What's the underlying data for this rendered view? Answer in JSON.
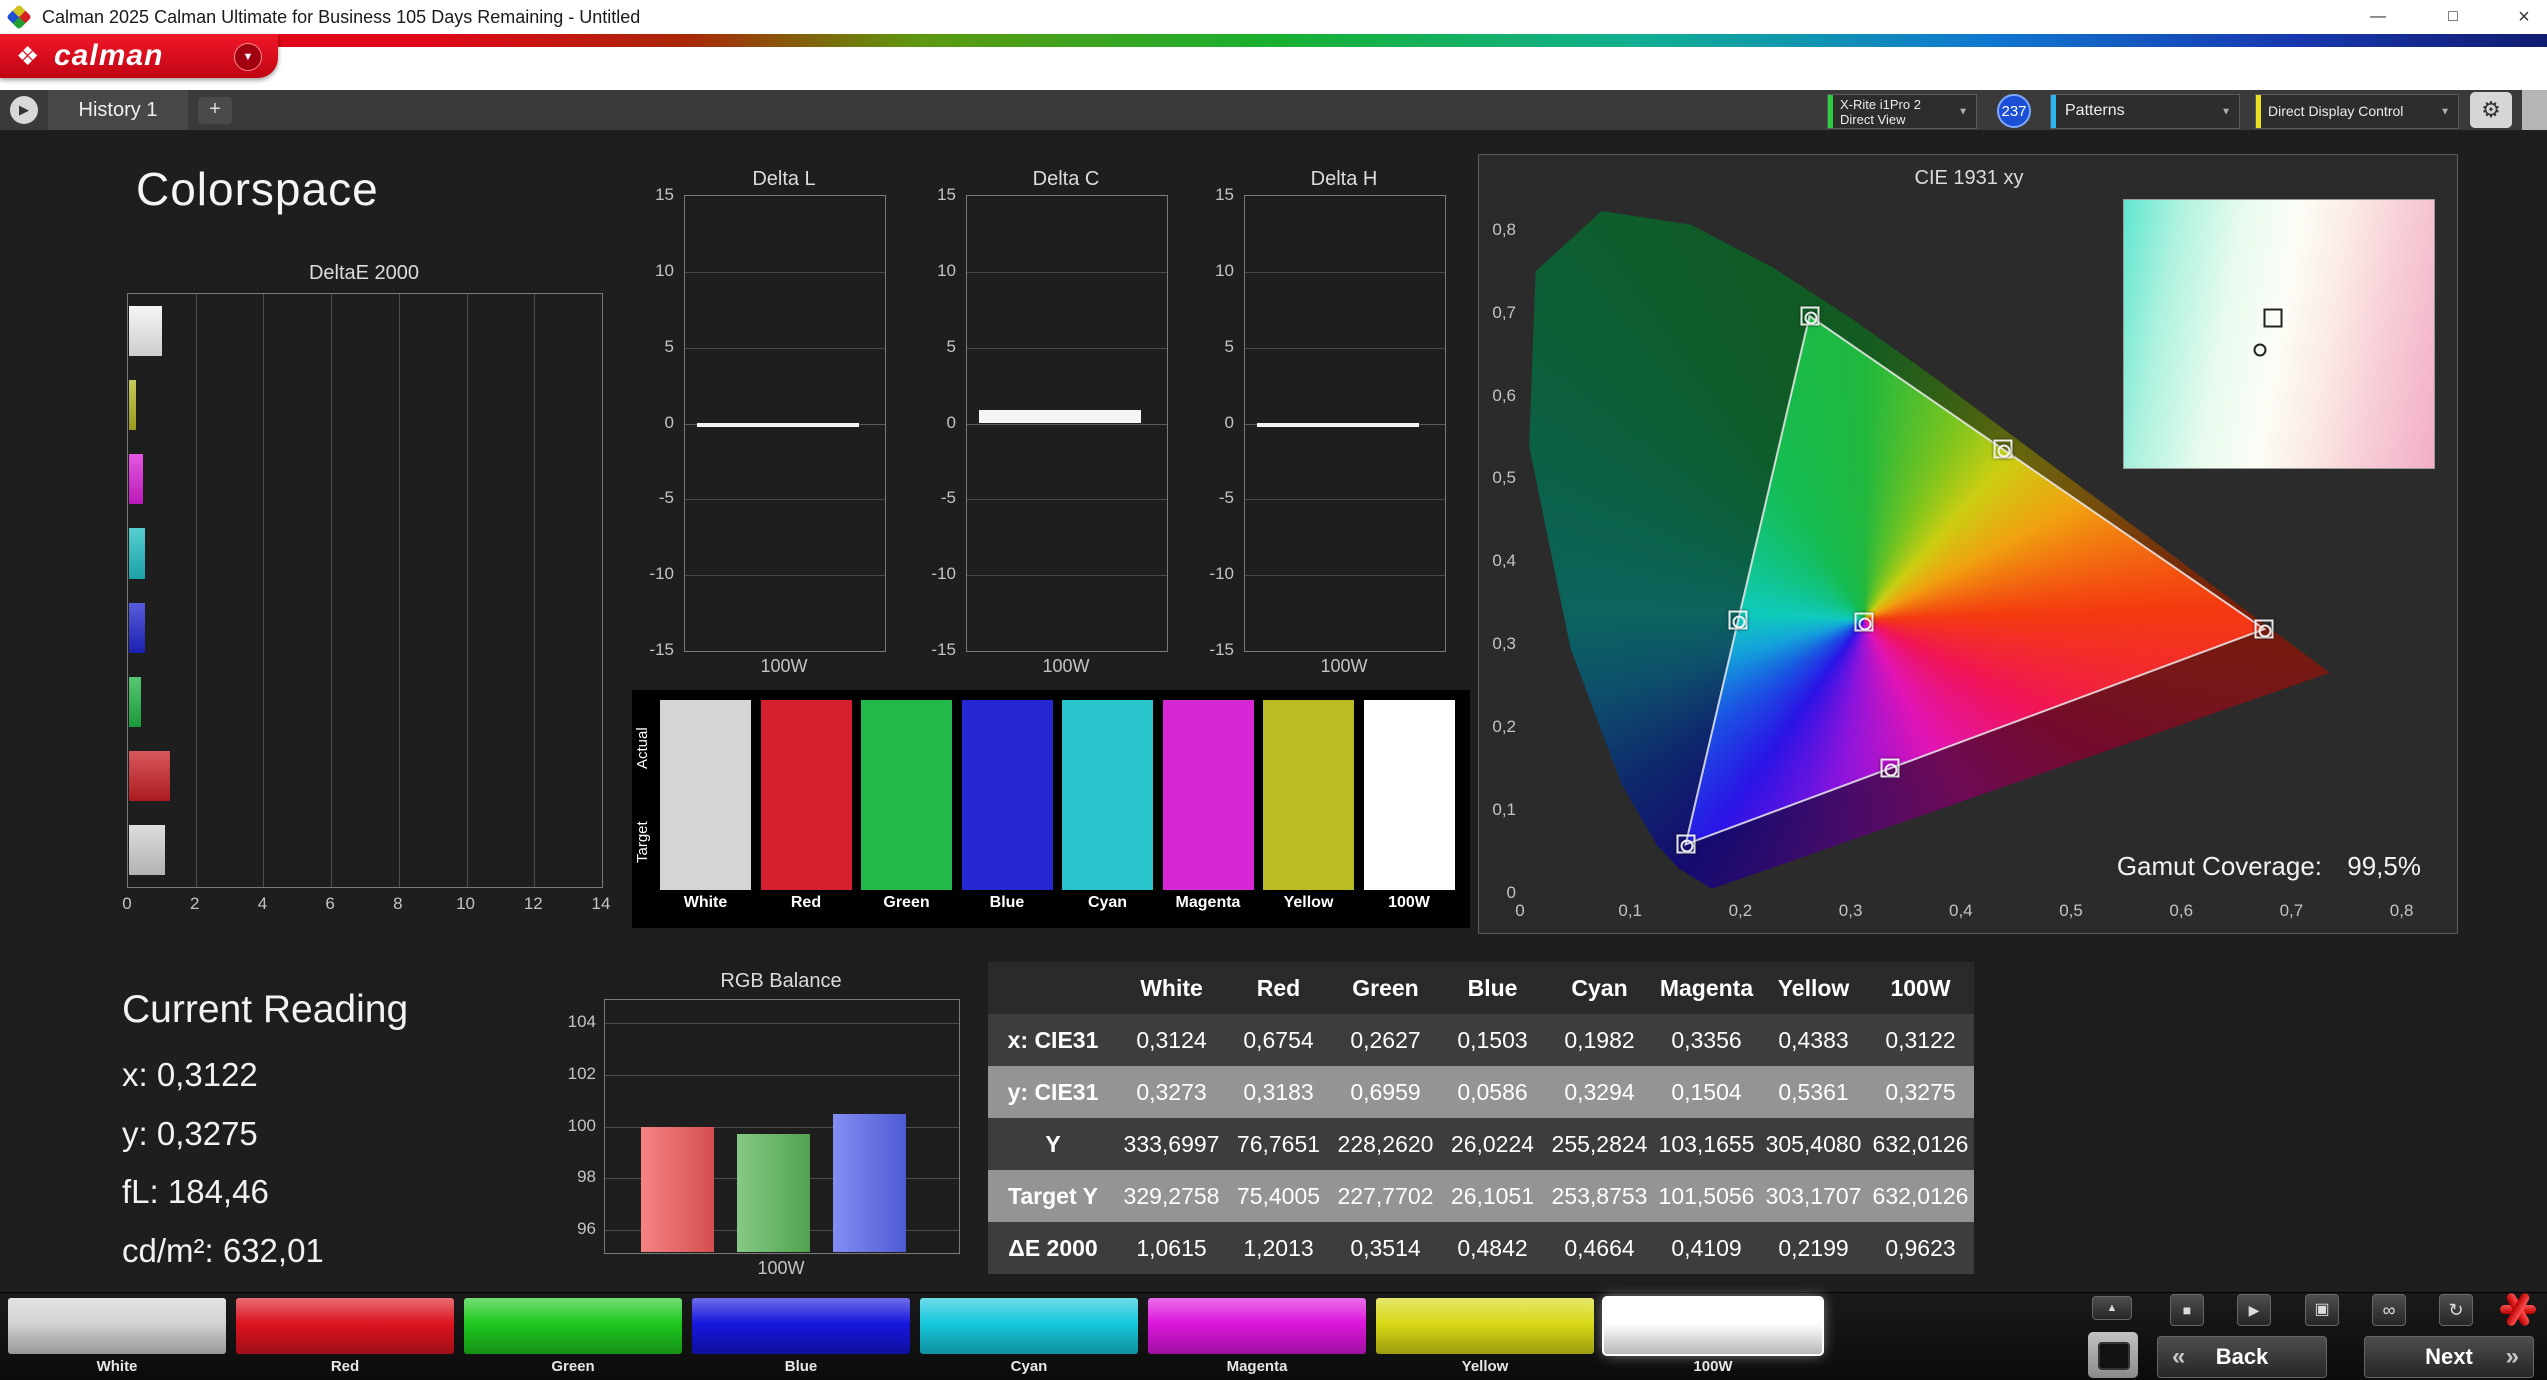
{
  "window": {
    "title": "Calman 2025 Calman Ultimate for Business 105 Days Remaining  - Untitled",
    "controls": {
      "minimize": "—",
      "restore": "□",
      "close": "×"
    }
  },
  "brand": {
    "logo_mark": "❖",
    "logo_text": "calman",
    "dropdown_icon": "▼"
  },
  "tabbar": {
    "history_button_icon": "▶",
    "tab": "History 1",
    "add_tab": "+",
    "meter_line1": "X-Rite i1Pro 2",
    "meter_line2": "Direct View",
    "meter_accent": "#2ecc40",
    "meter_badge": "237",
    "patterns": "Patterns",
    "patterns_accent": "#29b6f6",
    "display_control": "Direct Display Control",
    "ddc_accent": "#e8e020",
    "gear_icon": "⚙",
    "dropdown_icon": "▼"
  },
  "page_title": "Colorspace",
  "deltae": {
    "title": "DeltaE 2000",
    "max": 14,
    "xticks": [
      "0",
      "2",
      "4",
      "6",
      "8",
      "10",
      "12",
      "14"
    ],
    "bars": [
      {
        "name": "100W",
        "value": 0.9623,
        "color": "#f2f2f2"
      },
      {
        "name": "Yellow",
        "value": 0.2199,
        "color": "#b5b622"
      },
      {
        "name": "Magenta",
        "value": 0.4109,
        "color": "#da1fd8"
      },
      {
        "name": "Cyan",
        "value": 0.4664,
        "color": "#1fbdc2"
      },
      {
        "name": "Blue",
        "value": 0.4842,
        "color": "#2026cf"
      },
      {
        "name": "Green",
        "value": 0.3514,
        "color": "#1fb444"
      },
      {
        "name": "Red",
        "value": 1.2013,
        "color": "#c92025"
      },
      {
        "name": "White",
        "value": 1.0615,
        "color": "#d2d2d2"
      }
    ]
  },
  "delta_common": {
    "yticks": [
      "15",
      "10",
      "5",
      "0",
      "-5",
      "-10",
      "-15"
    ],
    "ytick_values": [
      15,
      10,
      5,
      0,
      -5,
      -10,
      -15
    ],
    "xlabel": "100W"
  },
  "delta_charts": [
    {
      "title": "Delta L",
      "value": 0.05
    },
    {
      "title": "Delta C",
      "value": 0.9
    },
    {
      "title": "Delta H",
      "value": 0.05
    }
  ],
  "swatches": {
    "row_label_actual": "Actual",
    "row_label_target": "Target",
    "items": [
      {
        "label": "White",
        "color": "#d5d5d5"
      },
      {
        "label": "Red",
        "color": "#d51f2f"
      },
      {
        "label": "Green",
        "color": "#22b94a"
      },
      {
        "label": "Blue",
        "color": "#2427d2"
      },
      {
        "label": "Cyan",
        "color": "#27c4cb"
      },
      {
        "label": "Magenta",
        "color": "#d527d5"
      },
      {
        "label": "Yellow",
        "color": "#babb25"
      },
      {
        "label": "100W",
        "color": "#ffffff"
      }
    ]
  },
  "cie": {
    "title": "CIE 1931 xy",
    "coverage_label": "Gamut Coverage:",
    "coverage_value": "99,5%",
    "xtick_labels": [
      "0",
      "0,1",
      "0,2",
      "0,3",
      "0,4",
      "0,5",
      "0,6",
      "0,7",
      "0,8"
    ],
    "xtick_values": [
      0,
      0.1,
      0.2,
      0.3,
      0.4,
      0.5,
      0.6,
      0.7,
      0.8
    ],
    "ytick_labels": [
      "0,8",
      "0,7",
      "0,6",
      "0,5",
      "0,4",
      "0,3",
      "0,2",
      "0,1",
      "0"
    ],
    "ytick_values": [
      0.8,
      0.7,
      0.6,
      0.5,
      0.4,
      0.3,
      0.2,
      0.1,
      0
    ],
    "points": [
      {
        "name": "White",
        "x": 0.3124,
        "y": 0.3273
      },
      {
        "name": "Red",
        "x": 0.6754,
        "y": 0.3183
      },
      {
        "name": "Green",
        "x": 0.2627,
        "y": 0.6959
      },
      {
        "name": "Blue",
        "x": 0.1503,
        "y": 0.0586
      },
      {
        "name": "Cyan",
        "x": 0.1982,
        "y": 0.3294
      },
      {
        "name": "Magenta",
        "x": 0.3356,
        "y": 0.1504
      },
      {
        "name": "Yellow",
        "x": 0.4383,
        "y": 0.5361
      }
    ],
    "triangle": [
      "Red",
      "Green",
      "Blue"
    ]
  },
  "current_reading": {
    "title": "Current Reading",
    "lines": [
      "x: 0,3122",
      "y: 0,3275",
      "fL: 184,46",
      "cd/m²: 632,01"
    ]
  },
  "rgb_balance": {
    "title": "RGB Balance",
    "ytick_values": [
      104,
      102,
      100,
      98,
      96
    ],
    "ymin": 95.1,
    "ymax": 104.9,
    "xlabel": "100W",
    "bars": [
      {
        "name": "Red",
        "value": 100.0,
        "color": "#f25a5a"
      },
      {
        "name": "Green",
        "value": 99.7,
        "color": "#5cb85c"
      },
      {
        "name": "Blue",
        "value": 100.5,
        "color": "#5a68f0"
      }
    ]
  },
  "table": {
    "columns": [
      "White",
      "Red",
      "Green",
      "Blue",
      "Cyan",
      "Magenta",
      "Yellow",
      "100W"
    ],
    "rows": [
      {
        "label": "x: CIE31",
        "values": [
          "0,3124",
          "0,6754",
          "0,2627",
          "0,1503",
          "0,1982",
          "0,3356",
          "0,4383",
          "0,3122"
        ]
      },
      {
        "label": "y: CIE31",
        "values": [
          "0,3273",
          "0,3183",
          "0,6959",
          "0,0586",
          "0,3294",
          "0,1504",
          "0,5361",
          "0,3275"
        ]
      },
      {
        "label": "Y",
        "values": [
          "333,6997",
          "76,7651",
          "228,2620",
          "26,0224",
          "255,2824",
          "103,1655",
          "305,4080",
          "632,0126"
        ]
      },
      {
        "label": "Target Y",
        "values": [
          "329,2758",
          "75,4005",
          "227,7702",
          "26,1051",
          "253,8753",
          "101,5056",
          "303,1707",
          "632,0126"
        ]
      },
      {
        "label": "ΔE 2000",
        "values": [
          "1,0615",
          "1,2013",
          "0,3514",
          "0,4842",
          "0,4664",
          "0,4109",
          "0,2199",
          "0,9623"
        ]
      }
    ]
  },
  "patterns_bar": {
    "buttons": [
      {
        "label": "White",
        "color": "#d2d2d2"
      },
      {
        "label": "Red",
        "color": "#dc1420"
      },
      {
        "label": "Green",
        "color": "#1ec81e"
      },
      {
        "label": "Blue",
        "color": "#1616dc"
      },
      {
        "label": "Cyan",
        "color": "#16c8dc"
      },
      {
        "label": "Magenta",
        "color": "#dc16dc"
      },
      {
        "label": "Yellow",
        "color": "#d8d816"
      },
      {
        "label": "100W",
        "color": "#ffffff",
        "selected": true
      }
    ]
  },
  "transport": {
    "up_icon": "▲",
    "stop_icon": "■",
    "play_icon": "▶",
    "save_icon": "▣",
    "link_icon": "∞",
    "refresh_icon": "↻",
    "back_icon": "«",
    "back": "Back",
    "next": "Next",
    "next_icon": "»"
  }
}
